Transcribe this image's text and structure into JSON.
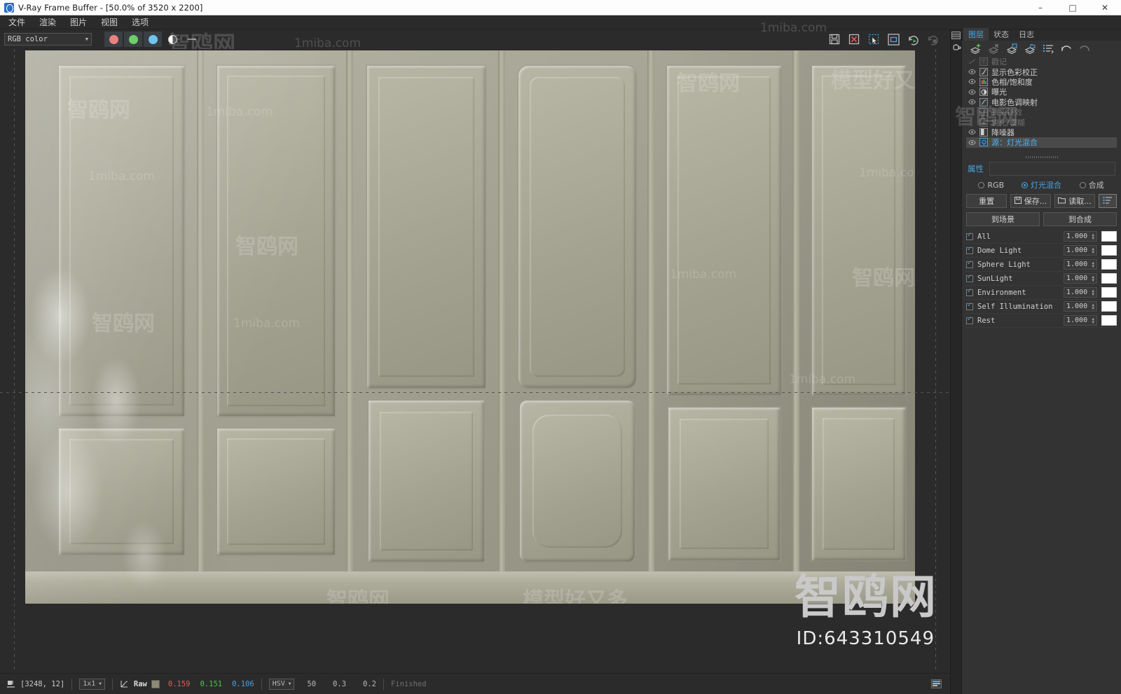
{
  "window": {
    "title": "V-Ray Frame Buffer - [50.0% of 3520 x 2200]",
    "app_icon": "vray-logo-icon",
    "minimize": "–",
    "maximize": "□",
    "close": "✕"
  },
  "menubar": {
    "items": [
      {
        "label": "文件",
        "name": "menu-file"
      },
      {
        "label": "渲染",
        "name": "menu-render"
      },
      {
        "label": "图片",
        "name": "menu-image"
      },
      {
        "label": "视图",
        "name": "menu-view"
      },
      {
        "label": "选项",
        "name": "menu-options"
      }
    ]
  },
  "toolbar": {
    "channel_select": "RGB color",
    "channels": [
      {
        "name": "red-channel-button",
        "color": "#e9817e"
      },
      {
        "name": "green-channel-button",
        "color": "#6ece6a"
      },
      {
        "name": "blue-channel-button",
        "color": "#72c3ef"
      },
      {
        "name": "alpha-channel-button",
        "color": "#ffffff"
      }
    ],
    "right_tools": [
      {
        "name": "save-image-icon",
        "tip": "保存图片"
      },
      {
        "name": "clear-image-icon",
        "tip": "清除图片"
      },
      {
        "name": "region-render-icon",
        "tip": "区域渲染"
      },
      {
        "name": "render-last-region-icon",
        "tip": "渲染上次区域"
      },
      {
        "name": "start-render-icon",
        "tip": "开始渲染"
      },
      {
        "name": "stop-render-icon",
        "tip": "停止渲染"
      }
    ]
  },
  "statusbar": {
    "pixel_icon": "pixel-lock-icon",
    "coordinates": "[3248,  12]",
    "sample_size": "1x1",
    "curve_icon": "curve-icon",
    "mode_label": "Raw",
    "swatch_color": "#8c8a74",
    "r": "0.159",
    "g": "0.151",
    "b": "0.106",
    "color_space": "HSV",
    "hsv_h": "50",
    "hsv_s": "0.3",
    "hsv_v": "0.2",
    "render_status": "Finished",
    "right_icon": "stats-panel-icon"
  },
  "rail": {
    "items": [
      {
        "name": "layers-toggle-icon",
        "glyph": "▤"
      },
      {
        "name": "teapot-preview-icon",
        "glyph": "teapot"
      }
    ]
  },
  "dock": {
    "tabs": [
      {
        "label": "图层",
        "name": "tab-layers",
        "active": true
      },
      {
        "label": "状态",
        "name": "tab-status",
        "active": false
      },
      {
        "label": "日志",
        "name": "tab-log",
        "active": false
      }
    ],
    "layer_tools": [
      {
        "name": "add-layer-icon"
      },
      {
        "name": "delete-layer-icon"
      },
      {
        "name": "save-layer-icon"
      },
      {
        "name": "load-layer-icon"
      },
      {
        "name": "layer-list-icon"
      },
      {
        "name": "undo-icon"
      },
      {
        "name": "redo-icon"
      }
    ],
    "layers": [
      {
        "label": "戳记",
        "icon": "stamp-icon",
        "visible": false,
        "enabled": false,
        "selected": false
      },
      {
        "label": "显示色彩校正",
        "icon": "curve-icon",
        "visible": true,
        "enabled": true,
        "selected": false
      },
      {
        "label": "色相/饱和度",
        "icon": "hue-sat-icon",
        "visible": true,
        "enabled": true,
        "selected": false
      },
      {
        "label": "曝光",
        "icon": "exposure-icon",
        "visible": true,
        "enabled": true,
        "selected": false
      },
      {
        "label": "电影色调映射",
        "icon": "film-tonemap-icon",
        "visible": true,
        "enabled": true,
        "selected": false
      },
      {
        "label": "镜头特效",
        "icon": "lens-effects-icon",
        "visible": false,
        "enabled": false,
        "selected": false
      },
      {
        "label": "锐化/模糊",
        "icon": "sharpen-blur-icon",
        "visible": false,
        "enabled": false,
        "selected": false
      },
      {
        "label": "降噪器",
        "icon": "denoiser-icon",
        "visible": true,
        "enabled": true,
        "selected": false
      },
      {
        "label": "源：灯光混合",
        "icon": "light-mix-icon",
        "visible": true,
        "enabled": true,
        "selected": true
      }
    ],
    "properties": {
      "title": "属性",
      "modes": [
        {
          "label": "RGB",
          "name": "mode-rgb",
          "selected": false
        },
        {
          "label": "灯光混合",
          "name": "mode-light-mix",
          "selected": true
        },
        {
          "label": "合成",
          "name": "mode-composite",
          "selected": false
        }
      ],
      "buttons": [
        {
          "label": "重置",
          "name": "reset-button",
          "icon": ""
        },
        {
          "label": "保存...",
          "name": "save-button",
          "icon": "save-icon"
        },
        {
          "label": "读取...",
          "name": "load-button",
          "icon": "folder-icon"
        },
        {
          "label": "",
          "name": "options-menu-button",
          "icon": "list-menu-icon"
        }
      ],
      "apply_buttons": [
        {
          "label": "到场景",
          "name": "to-scene-button"
        },
        {
          "label": "到合成",
          "name": "to-composite-button"
        }
      ],
      "light_mix": [
        {
          "name": "All",
          "checked": true,
          "value": "1.000",
          "color": "#ffffff"
        },
        {
          "name": "Dome Light",
          "checked": true,
          "value": "1.000",
          "color": "#ffffff"
        },
        {
          "name": "Sphere Light",
          "checked": true,
          "value": "1.000",
          "color": "#ffffff"
        },
        {
          "name": "SunLight",
          "checked": true,
          "value": "1.000",
          "color": "#ffffff"
        },
        {
          "name": "Environment",
          "checked": true,
          "value": "1.000",
          "color": "#ffffff"
        },
        {
          "name": "Self Illumination",
          "checked": true,
          "value": "1.000",
          "color": "#ffffff"
        },
        {
          "name": "Rest",
          "checked": true,
          "value": "1.000",
          "color": "#ffffff"
        }
      ]
    }
  },
  "watermarks": {
    "brand_cn": "智鸥网",
    "brand_url": "1miba.com",
    "tagline": "模型好又多",
    "id_label": "ID:643310549"
  }
}
